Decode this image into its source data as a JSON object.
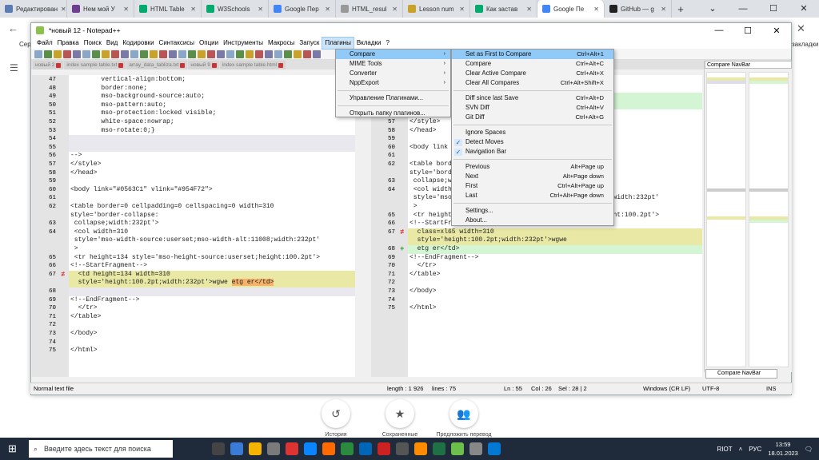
{
  "browser": {
    "tabs": [
      {
        "label": "Редактирован",
        "color": "#5b7db1"
      },
      {
        "label": "Нем мой У",
        "color": "#6e3f8f"
      },
      {
        "label": "HTML Table",
        "color": "#04aa6d"
      },
      {
        "label": "W3Schools",
        "color": "#04aa6d"
      },
      {
        "label": "Google Пер",
        "color": "#4285f4"
      },
      {
        "label": "HTML_resul",
        "color": "#999999"
      },
      {
        "label": "Lesson num",
        "color": "#c9a227"
      },
      {
        "label": "Как застав",
        "color": "#04aa6d"
      },
      {
        "label": "Google Пе",
        "color": "#4285f4",
        "active": true
      },
      {
        "label": "GitHub — g",
        "color": "#222222"
      }
    ],
    "bookmarks_left": "Серв",
    "bookmarks_right": "закладки"
  },
  "npp": {
    "title": "*новый 12 - Notepad++",
    "menu": [
      "Файл",
      "Правка",
      "Поиск",
      "Вид",
      "Кодировки",
      "Синтаксисы",
      "Опции",
      "Инструменты",
      "Макросы",
      "Запуск",
      "Плагины",
      "Вкладки",
      "?"
    ],
    "file_tabs": [
      "новый 2",
      "index sample table.txt",
      "array_data_tabliza.txt",
      "новый 9",
      "index sample table.html"
    ],
    "left_lines": [
      {
        "n": "47",
        "t": "        vertical-align:bottom;"
      },
      {
        "n": "48",
        "t": "        border:none;"
      },
      {
        "n": "49",
        "t": "        mso-background-source:auto;"
      },
      {
        "n": "50",
        "t": "        mso-pattern:auto;"
      },
      {
        "n": "51",
        "t": "        mso-protection:locked visible;"
      },
      {
        "n": "52",
        "t": "        white-space:nowrap;"
      },
      {
        "n": "53",
        "t": "        mso-rotate:0;}"
      },
      {
        "n": "54",
        "t": "",
        "c": "hl-blank"
      },
      {
        "n": "55",
        "t": "",
        "c": "hl-blank"
      },
      {
        "n": "56",
        "t": "-->"
      },
      {
        "n": "57",
        "t": "</style>"
      },
      {
        "n": "58",
        "t": "</head>"
      },
      {
        "n": "59",
        "t": ""
      },
      {
        "n": "60",
        "t": "<body link=\"#0563C1\" vlink=\"#954F72\">"
      },
      {
        "n": "61",
        "t": ""
      },
      {
        "n": "62",
        "t": "<table border=0 cellpadding=0 cellspacing=0 width=310"
      },
      {
        "n": "",
        "t": "style='border-collapse:"
      },
      {
        "n": "63",
        "t": " collapse;width:232pt'>"
      },
      {
        "n": "64",
        "t": " <col width=310"
      },
      {
        "n": "",
        "t": " style='mso-width-source:userset;mso-width-alt:11008;width:232pt'"
      },
      {
        "n": "",
        "t": " >"
      },
      {
        "n": "65",
        "t": " <tr height=134 style='mso-height-source:userset;height:100.2pt'>"
      },
      {
        "n": "66",
        "t": "<!--StartFragment-->"
      },
      {
        "n": "67",
        "t": "  <td height=134 width=310",
        "c": "hl-mod",
        "m": "≢"
      },
      {
        "n": "",
        "t": "  style='height:100.2pt;width:232pt'>wgwe etg er</td>",
        "c": "hl-mod"
      },
      {
        "n": "68",
        "t": "",
        "c": "hl-blank"
      },
      {
        "n": "69",
        "t": "<!--EndFragment-->"
      },
      {
        "n": "70",
        "t": "  </tr>"
      },
      {
        "n": "71",
        "t": "</table>"
      },
      {
        "n": "72",
        "t": ""
      },
      {
        "n": "73",
        "t": "</body>"
      },
      {
        "n": "74",
        "t": ""
      },
      {
        "n": "75",
        "t": "</html>"
      }
    ],
    "right_lines": [
      {
        "n": "52",
        "t": "        white-"
      },
      {
        "n": "53",
        "t": "        mso-ro"
      },
      {
        "n": "54",
        "t": ".xl65",
        "c": "hl-add",
        "m": "+"
      },
      {
        "n": "55",
        "t": "    (verti",
        "c": "hl-add",
        "m": "+"
      },
      {
        "n": "56",
        "t": "-->"
      },
      {
        "n": "57",
        "t": "</style>"
      },
      {
        "n": "58",
        "t": "</head>"
      },
      {
        "n": "59",
        "t": ""
      },
      {
        "n": "60",
        "t": "<body link"
      },
      {
        "n": "61",
        "t": ""
      },
      {
        "n": "62",
        "t": "<table border=0 cellpadding=0 cellspacing=0 width=310"
      },
      {
        "n": "",
        "t": "style='border-collapse:"
      },
      {
        "n": "63",
        "t": " collapse;width:232pt'>"
      },
      {
        "n": "64",
        "t": " <col width=310"
      },
      {
        "n": "",
        "t": " style='mso-width-source:userset;mso-width-alt:11008;width:232pt'"
      },
      {
        "n": "",
        "t": " >"
      },
      {
        "n": "65",
        "t": " <tr height=134 style='mso-height-source:userset;height:100.2pt'>"
      },
      {
        "n": "66",
        "t": "<!--StartFragment-->"
      },
      {
        "n": "67",
        "t": "  <td height=134 class=xl65 width=310",
        "c": "hl-mod",
        "m": "≢"
      },
      {
        "n": "",
        "t": "  style='height:100.2pt;width:232pt'>wgwe",
        "c": "hl-mod"
      },
      {
        "n": "68",
        "t": "  etg er</td>",
        "c": "hl-add",
        "m": "+"
      },
      {
        "n": "69",
        "t": "<!--EndFragment-->"
      },
      {
        "n": "70",
        "t": "  </tr>"
      },
      {
        "n": "71",
        "t": "</table>"
      },
      {
        "n": "72",
        "t": ""
      },
      {
        "n": "73",
        "t": "</body>"
      },
      {
        "n": "74",
        "t": ""
      },
      {
        "n": "75",
        "t": "</html>"
      }
    ],
    "navbar_title": "Compare NavBar",
    "navbar_footer": "Compare NavBar",
    "status": {
      "type": "Normal text file",
      "length": "length : 1 926",
      "lines": "lines : 75",
      "pos": "Ln : 55",
      "col": "Col : 26",
      "sel": "Sel : 28 | 2",
      "eol": "Windows (CR LF)",
      "enc": "UTF-8",
      "ins": "INS"
    }
  },
  "plugins_menu": [
    {
      "label": "Compare",
      "sub": true,
      "sel": true
    },
    {
      "label": "MIME Tools",
      "sub": true
    },
    {
      "label": "Converter",
      "sub": true
    },
    {
      "label": "NppExport",
      "sub": true
    },
    {
      "sep": true
    },
    {
      "label": "Управление Плагинами..."
    },
    {
      "sep": true
    },
    {
      "label": "Открыть папку плагинов..."
    }
  ],
  "compare_menu": [
    {
      "label": "Set as First to Compare",
      "sc": "Ctrl+Alt+1",
      "sel": true
    },
    {
      "label": "Compare",
      "sc": "Ctrl+Alt+C"
    },
    {
      "label": "Clear Active Compare",
      "sc": "Ctrl+Alt+X"
    },
    {
      "label": "Clear All Compares",
      "sc": "Ctrl+Alt+Shift+X"
    },
    {
      "sep": true
    },
    {
      "label": "Diff since last Save",
      "sc": "Ctrl+Alt+D"
    },
    {
      "label": "SVN Diff",
      "sc": "Ctrl+Alt+V"
    },
    {
      "label": "Git Diff",
      "sc": "Ctrl+Alt+G"
    },
    {
      "sep": true
    },
    {
      "label": "Ignore Spaces"
    },
    {
      "label": "Detect Moves",
      "chk": true
    },
    {
      "label": "Navigation Bar",
      "chk": true
    },
    {
      "sep": true
    },
    {
      "label": "Previous",
      "sc": "Alt+Page up"
    },
    {
      "label": "Next",
      "sc": "Alt+Page down"
    },
    {
      "label": "First",
      "sc": "Ctrl+Alt+Page up"
    },
    {
      "label": "Last",
      "sc": "Ctrl+Alt+Page down"
    },
    {
      "sep": true
    },
    {
      "label": "Settings..."
    },
    {
      "label": "About..."
    }
  ],
  "google_footer": [
    {
      "label": "История",
      "icon": "history-icon",
      "glyph": "↺"
    },
    {
      "label": "Сохраненные",
      "icon": "star-icon",
      "glyph": "★"
    },
    {
      "label": "Предложить перевод",
      "icon": "people-icon",
      "glyph": "👥"
    }
  ],
  "taskbar": {
    "search_placeholder": "Введите здесь текст для поиска",
    "tray_riot": "RIOT",
    "lang": "РУС",
    "time": "13:59",
    "date": "18.01.2023",
    "apps": [
      "#444",
      "#3a7bd5",
      "#f4b400",
      "#7a7a7a",
      "#d33",
      "#0a84ff",
      "#ff6b00",
      "#2b8a3e",
      "#0067b8",
      "#c22",
      "#555",
      "#ff8c00",
      "#1e7145",
      "#6cbf4a",
      "#888",
      "#0078d4"
    ]
  }
}
